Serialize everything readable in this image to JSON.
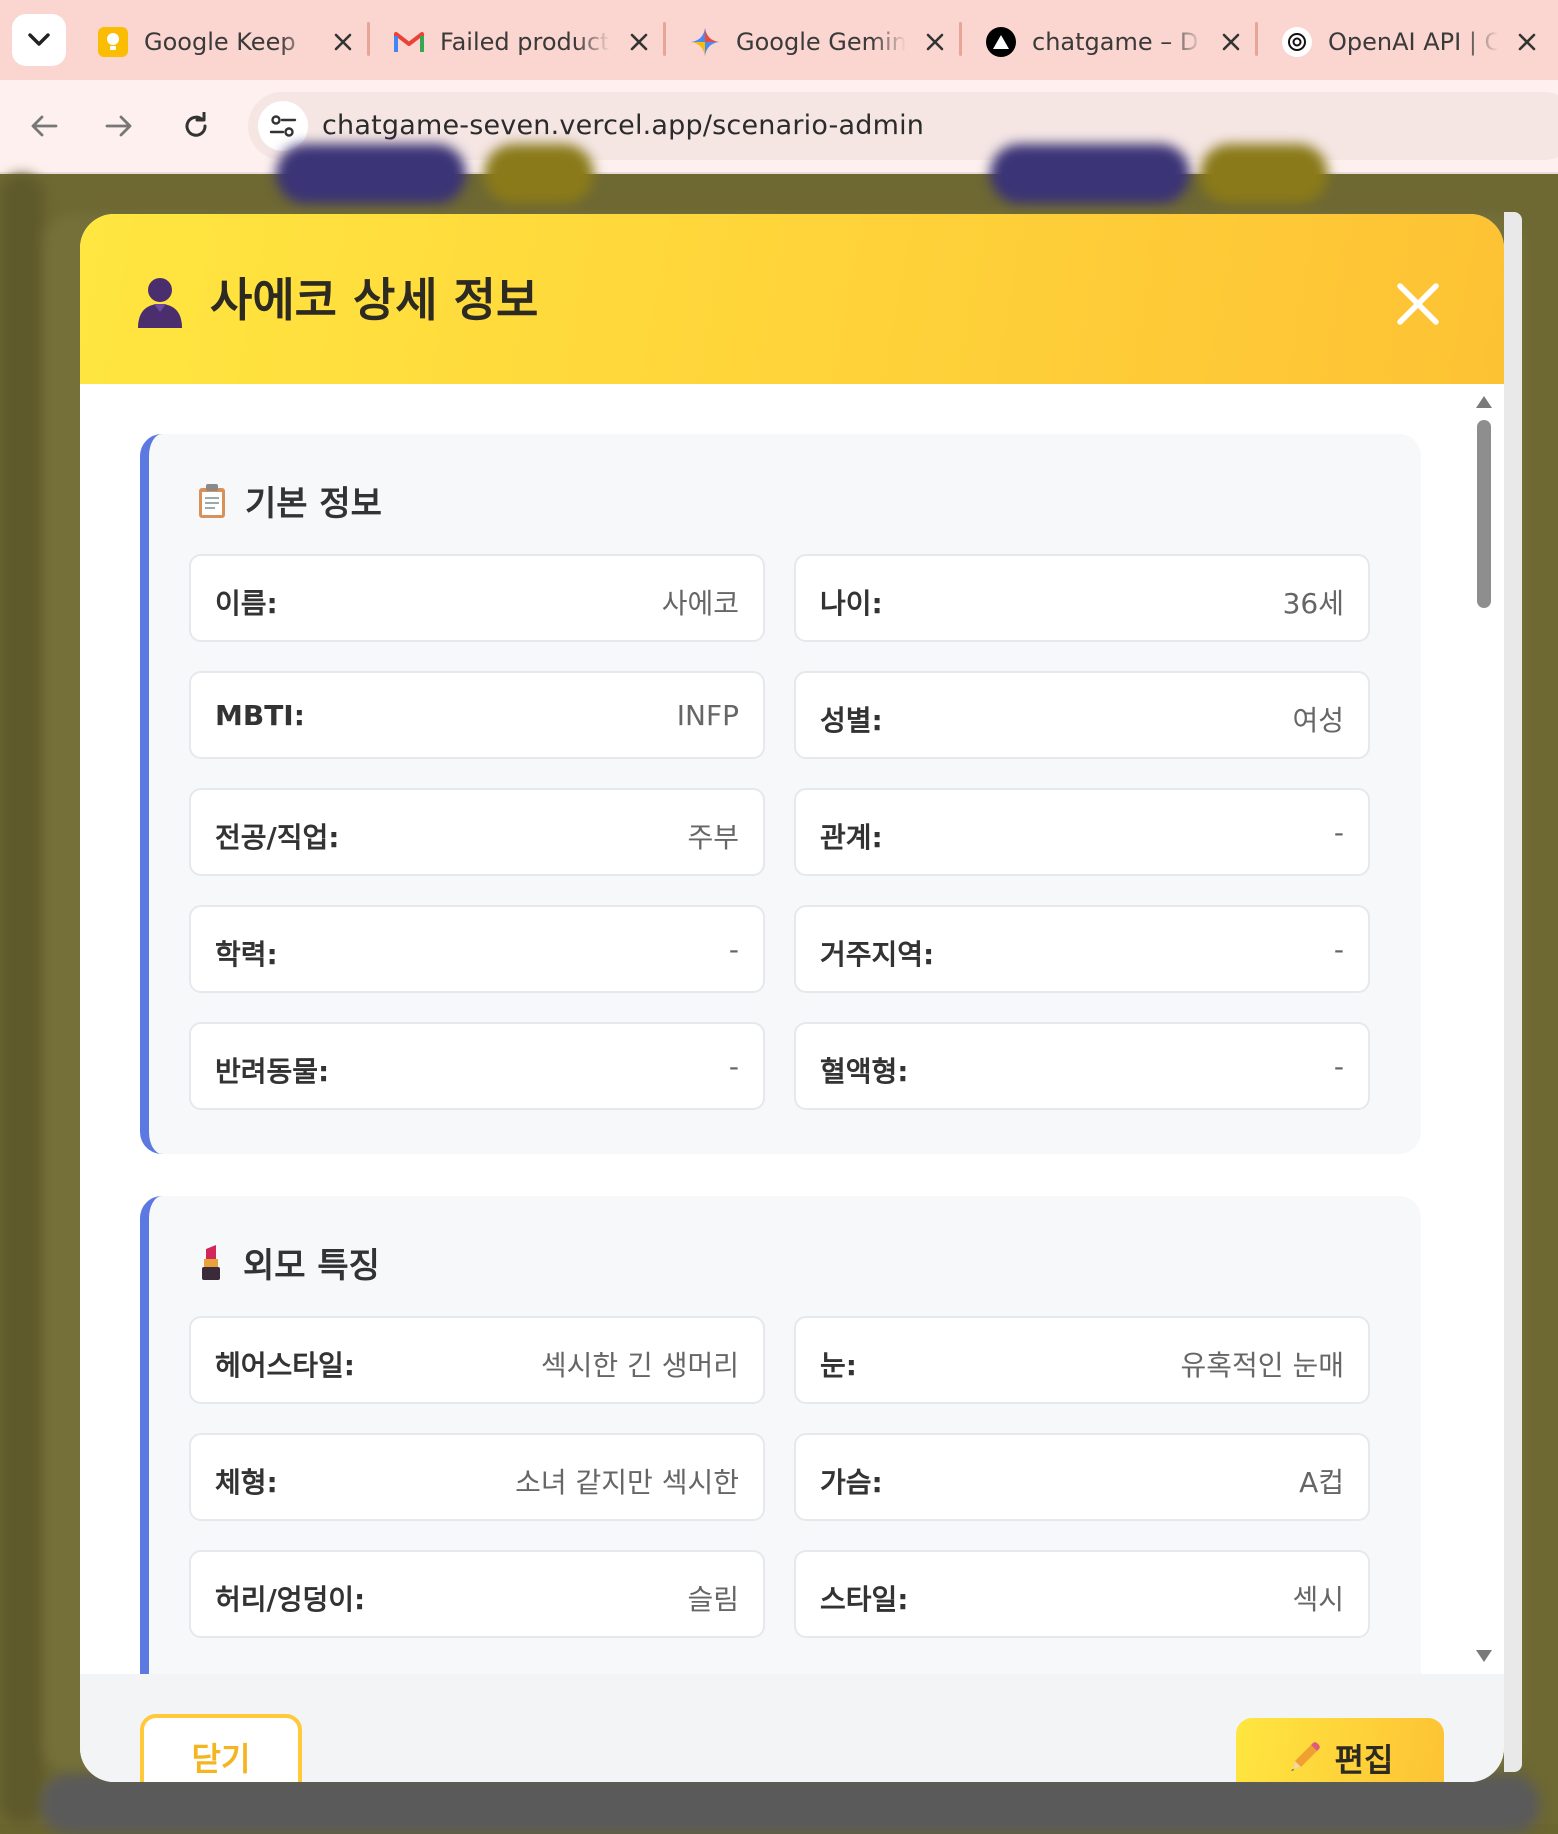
{
  "browser": {
    "tabs": [
      {
        "title": "Google Keep",
        "icon": "keep-icon",
        "color": "#fbbc04"
      },
      {
        "title": "Failed product",
        "icon": "gmail-icon",
        "color": "#ea4335"
      },
      {
        "title": "Google Gemini",
        "icon": "gemini-icon",
        "color": "#4a8af4"
      },
      {
        "title": "chatgame – D",
        "icon": "vercel-icon",
        "color": "#000000"
      },
      {
        "title": "OpenAI API | C",
        "icon": "openai-icon",
        "color": "#000000"
      }
    ],
    "url": "chatgame-seven.vercel.app/scenario-admin"
  },
  "modal": {
    "title": "사에코 상세 정보",
    "sections": [
      {
        "title": "기본 정보",
        "icon": "clipboard-icon",
        "fields": [
          {
            "label": "이름:",
            "value": "사에코"
          },
          {
            "label": "나이:",
            "value": "36세"
          },
          {
            "label": "MBTI:",
            "value": "INFP"
          },
          {
            "label": "성별:",
            "value": "여성"
          },
          {
            "label": "전공/직업:",
            "value": "주부"
          },
          {
            "label": "관계:",
            "value": "-"
          },
          {
            "label": "학력:",
            "value": "-"
          },
          {
            "label": "거주지역:",
            "value": "-"
          },
          {
            "label": "반려동물:",
            "value": "-"
          },
          {
            "label": "혈액형:",
            "value": "-"
          }
        ]
      },
      {
        "title": "외모 특징",
        "icon": "lipstick-icon",
        "fields": [
          {
            "label": "헤어스타일:",
            "value": "섹시한 긴 생머리"
          },
          {
            "label": "눈:",
            "value": "유혹적인 눈매"
          },
          {
            "label": "체형:",
            "value": "소녀 같지만 섹시한"
          },
          {
            "label": "가슴:",
            "value": "A컵"
          },
          {
            "label": "허리/엉덩이:",
            "value": "슬림"
          },
          {
            "label": "스타일:",
            "value": "섹시"
          }
        ]
      }
    ],
    "footer": {
      "close_label": "닫기",
      "edit_label": "편집"
    }
  },
  "colors": {
    "header_gradient_start": "#ffe640",
    "header_gradient_end": "#fdc234",
    "section_accent": "#5b79e0"
  }
}
